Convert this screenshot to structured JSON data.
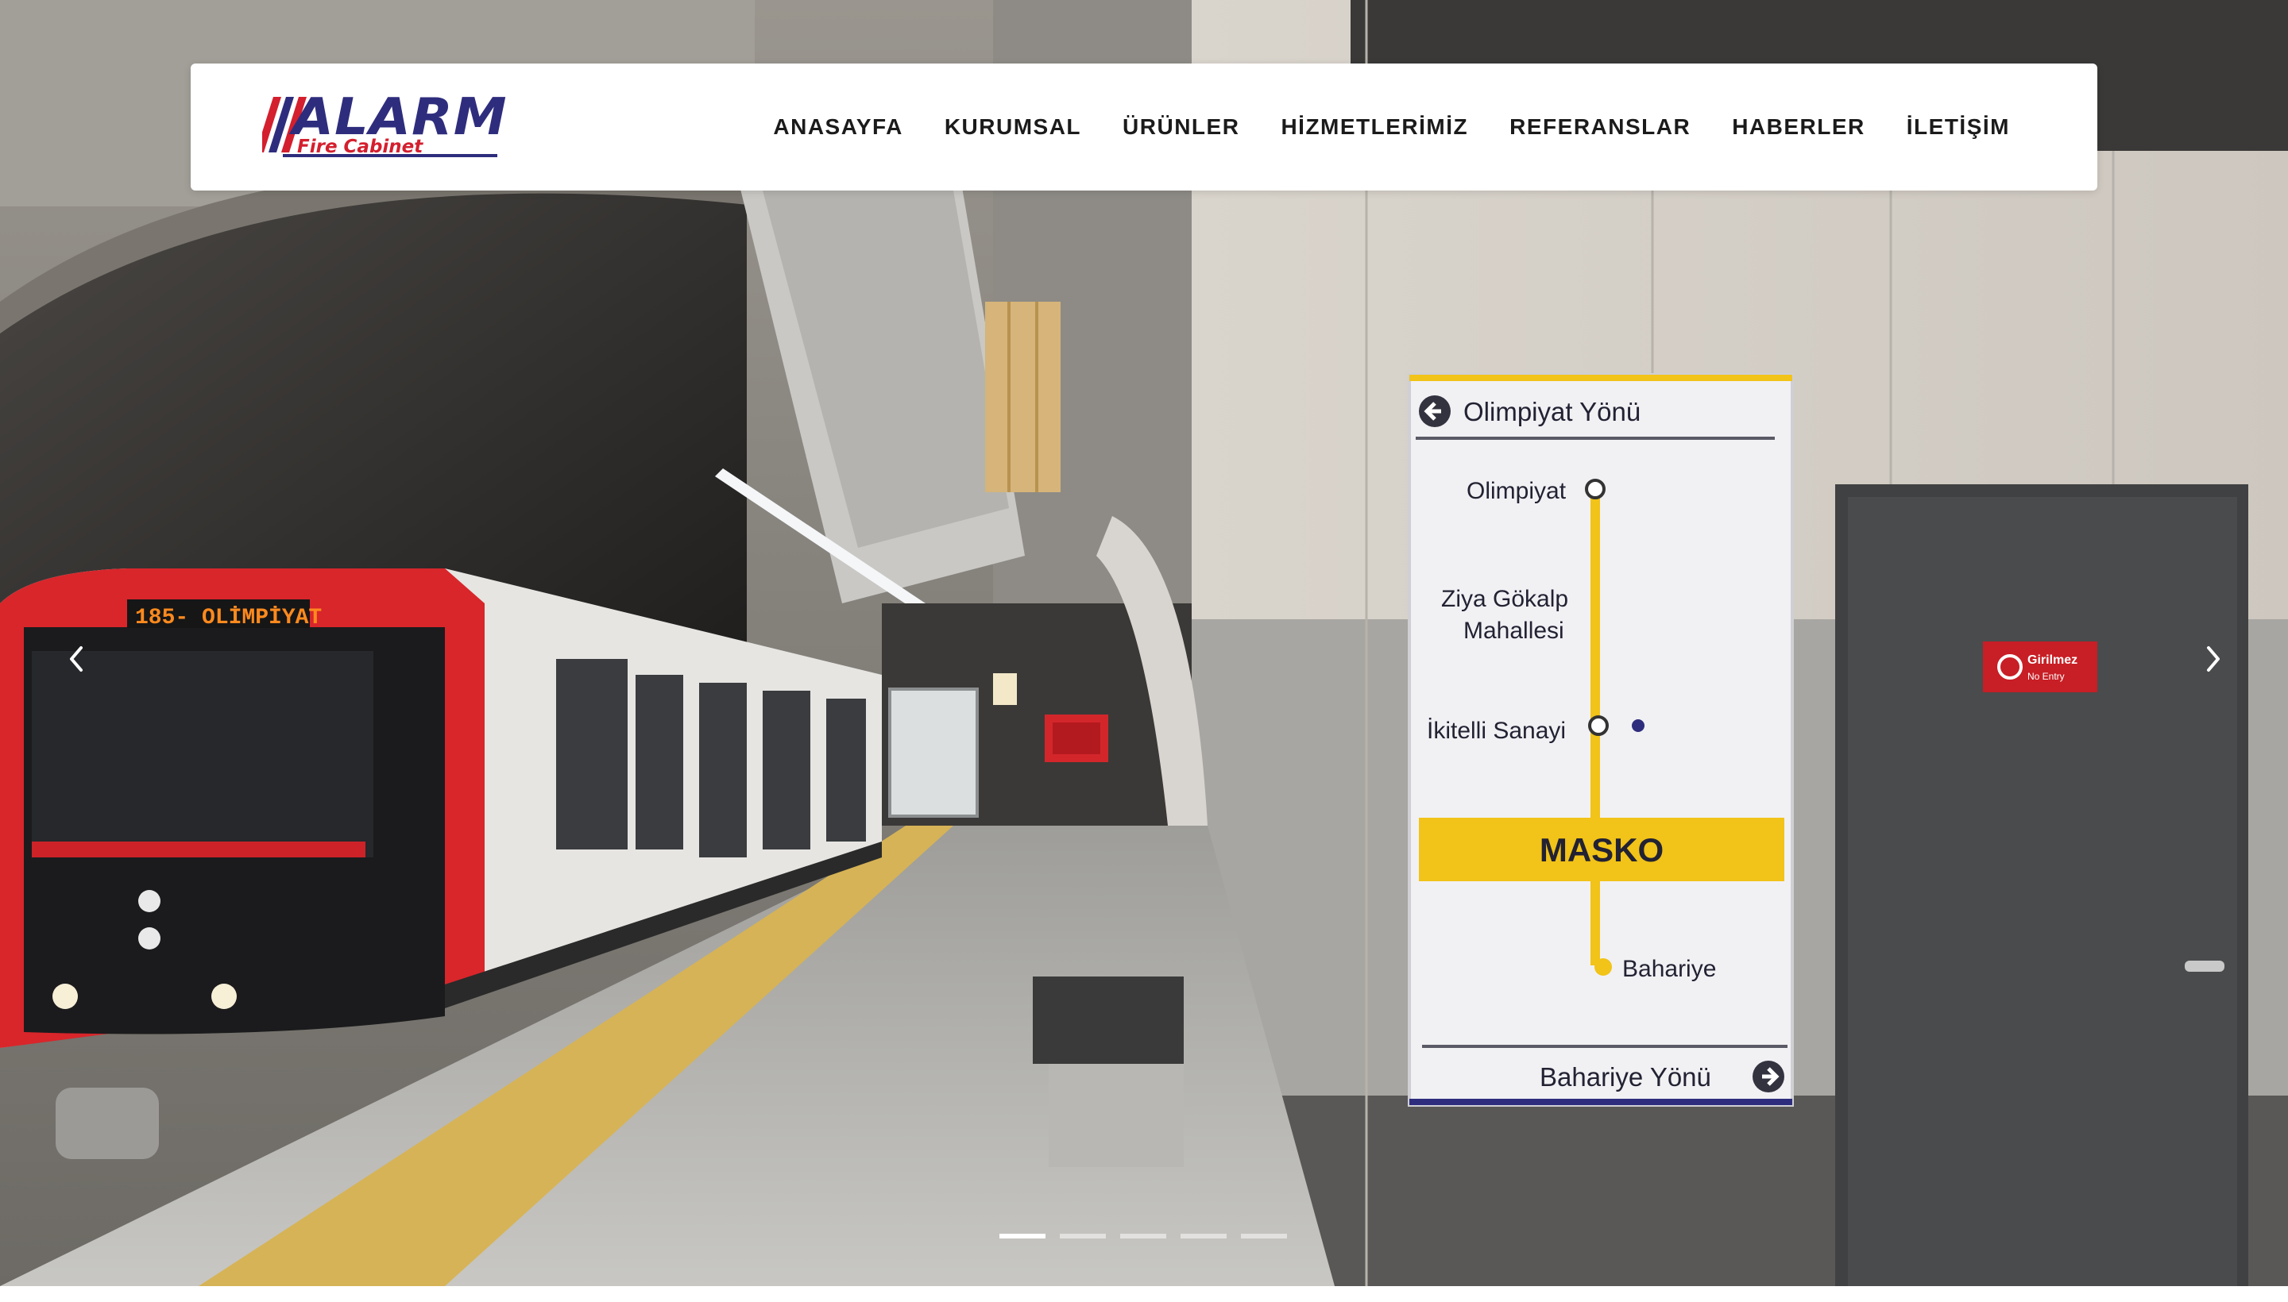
{
  "brand": {
    "name": "ALARM",
    "tagline": "Fire Cabinet",
    "colors": {
      "primary": "#2e2d7d",
      "accent": "#d41f2e"
    }
  },
  "nav": {
    "items": [
      {
        "label": "ANASAYFA"
      },
      {
        "label": "KURUMSAL"
      },
      {
        "label": "ÜRÜNLER"
      },
      {
        "label": "HİZMETLERİMİZ"
      },
      {
        "label": "REFERANSLAR"
      },
      {
        "label": "HABERLER"
      },
      {
        "label": "İLETİŞİM"
      }
    ]
  },
  "slider": {
    "prev_icon": "chevron-left-icon",
    "next_icon": "chevron-right-icon",
    "slide_count": 5,
    "active_index": 0,
    "slide": {
      "train_display": "185- OLİMPİYAT",
      "sign": {
        "top_direction": "Olimpiyat Yönü",
        "stations": [
          "Olimpiyat",
          "Ziya Gökalp",
          "Mahallesi",
          "İkitelli Sanayi"
        ],
        "current_station": "MASKO",
        "next_station": "Bahariye",
        "bottom_direction": "Bahariye Yönü"
      },
      "door_sign": {
        "line1": "Girilmez",
        "line2": "No Entry"
      }
    }
  }
}
